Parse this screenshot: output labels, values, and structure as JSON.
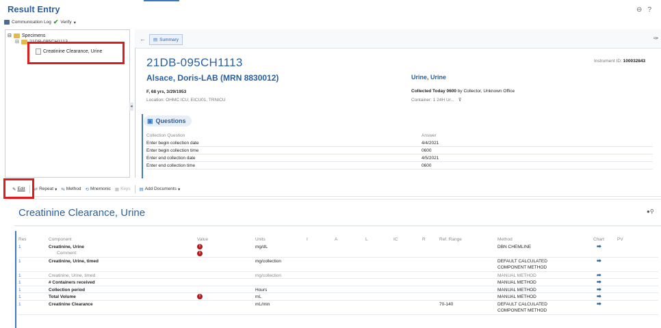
{
  "app": {
    "title": "Result Entry"
  },
  "toolbar1": {
    "communication_log": "Communication Log",
    "verify": "Verify"
  },
  "tree": {
    "root_label": "Specimens",
    "child_label": "21DB-095CH1113",
    "item_label": "Creatinine Clearance, Urine"
  },
  "summary": {
    "tab_label": "Summary"
  },
  "specimen": {
    "accession": "21DB-095CH1113",
    "instrument_label": "Instrument ID:",
    "instrument_id": "100032843",
    "patient_name": "Alsace, Doris-LAB (MRN 8830012)",
    "demographics": "F, 68 yrs, 3/29/1953",
    "location": "Location: OHMC ICU, EICU01, TRNICU",
    "specimen_type": "Urine, Urine",
    "collected_bold": "Collected Today 0600",
    "collected_rest": " by Collector, Unknown Office",
    "container": "Container: 1 24H Ur..."
  },
  "questions": {
    "title": "Questions",
    "headers": [
      "Collection Question",
      "Answer"
    ],
    "rows": [
      [
        "Enter begin collection date",
        "4/4/2021"
      ],
      [
        "Enter begin collection time",
        "0600"
      ],
      [
        "Enter end collection date",
        "4/5/2021"
      ],
      [
        "Enter end collection time",
        "0600"
      ]
    ]
  },
  "toolbar2": {
    "edit": "Edit",
    "repeat": "Repeat",
    "method": "Method",
    "mnemonic": "Mnemonic",
    "keys": "Keys",
    "add_documents": "Add Documents"
  },
  "results": {
    "title": "Creatinine Clearance, Urine",
    "headers": {
      "res": "Res",
      "component": "Component",
      "value": "Value",
      "units": "Units",
      "i": "I",
      "a": "A",
      "l": "L",
      "c": "IC",
      "r": "R",
      "ref": "Ref. Range",
      "method": "Method",
      "chart": "Chart",
      "pv": "PV"
    },
    "rows": [
      {
        "res": "1",
        "component": "Creatinine, Urine",
        "sub": "Comment:",
        "alert": true,
        "sub_alert": true,
        "units": "mg/dL",
        "ref": "",
        "method": "DBN CHEMLINE",
        "method2": "",
        "chart": true,
        "style": "bold"
      },
      {
        "res": "1",
        "component": "Creatinine, Urine, timed",
        "alert": false,
        "units": "mg/collection",
        "ref": "",
        "method": "DEFAULT CALCULATED",
        "method2": "COMPONENT METHOD",
        "chart": true,
        "style": "bold"
      },
      {
        "res": "1",
        "component": "Creatinine, Urine, timed",
        "alert": false,
        "units": "mg/collection",
        "ref": "",
        "method": "MANUAL METHOD",
        "method2": "",
        "chart": true,
        "style": "muted"
      },
      {
        "res": "1",
        "component": "# Containers received",
        "alert": false,
        "units": "",
        "ref": "",
        "method": "MANUAL METHOD",
        "method2": "",
        "chart": true,
        "style": "bold"
      },
      {
        "res": "1",
        "component": "Collection period",
        "alert": false,
        "units": "Hours",
        "ref": "",
        "method": "MANUAL METHOD",
        "method2": "",
        "chart": true,
        "style": "bold"
      },
      {
        "res": "1",
        "component": "Total Volume",
        "alert": true,
        "units": "mL",
        "ref": "",
        "method": "MANUAL METHOD",
        "method2": "",
        "chart": true,
        "style": "bold"
      },
      {
        "res": "1",
        "component": "Creatinine Clearance",
        "alert": false,
        "units": "mL/min",
        "ref": "70-140",
        "method": "DEFAULT CALCULATED",
        "method2": "COMPONENT METHOD",
        "chart": true,
        "style": "bold"
      }
    ]
  },
  "colors": {
    "accent": "#2a5f9e",
    "highlight": "#e01b1b",
    "alert": "#b3171a"
  }
}
